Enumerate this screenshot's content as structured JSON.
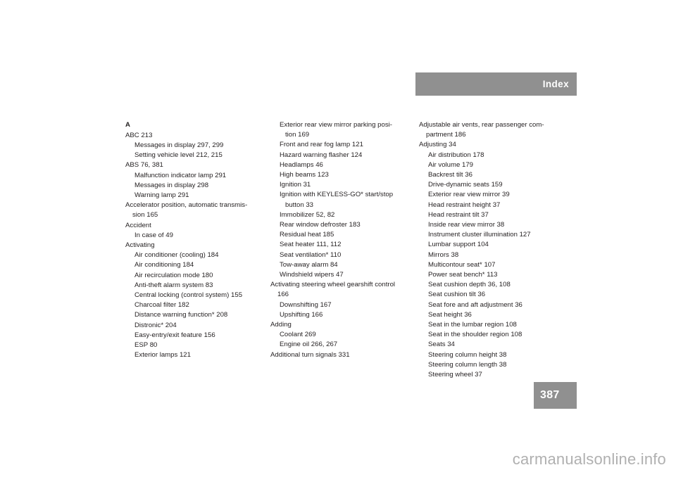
{
  "header": {
    "title": "Index",
    "bar_color": "#909090"
  },
  "page_number": {
    "value": "387",
    "box_color": "#909090"
  },
  "watermark": {
    "text": "carmanualsonline.info",
    "color": "#b0b0b0"
  },
  "columns": [
    {
      "id": "column-1",
      "entries": [
        {
          "level": "heading",
          "text": "A"
        },
        {
          "level": 0,
          "text": "ABC 213"
        },
        {
          "level": 1,
          "text": "Messages in display 297, 299"
        },
        {
          "level": 1,
          "text": "Setting vehicle level 212, 215"
        },
        {
          "level": 0,
          "text": "ABS 76, 381"
        },
        {
          "level": 1,
          "text": "Malfunction indicator lamp 291"
        },
        {
          "level": 1,
          "text": "Messages in display 298"
        },
        {
          "level": 1,
          "text": "Warning lamp 291"
        },
        {
          "level": 0,
          "text": "Accelerator position, automatic transmis-\nsion 165"
        },
        {
          "level": 0,
          "text": "Accident"
        },
        {
          "level": 1,
          "text": "In case of 49"
        },
        {
          "level": 0,
          "text": "Activating"
        },
        {
          "level": 1,
          "text": "Air conditioner (cooling) 184"
        },
        {
          "level": 1,
          "text": "Air conditioning 184"
        },
        {
          "level": 1,
          "text": "Air recirculation mode 180"
        },
        {
          "level": 1,
          "text": "Anti-theft alarm system 83"
        },
        {
          "level": 1,
          "text": "Central locking (control system) 155"
        },
        {
          "level": 1,
          "text": "Charcoal filter 182"
        },
        {
          "level": 1,
          "text": "Distance warning function* 208"
        },
        {
          "level": 1,
          "text": "Distronic* 204"
        },
        {
          "level": 1,
          "text": "Easy-entry/exit feature 156"
        },
        {
          "level": 1,
          "text": "ESP 80"
        },
        {
          "level": 1,
          "text": "Exterior lamps 121"
        }
      ]
    },
    {
      "id": "column-2",
      "entries": [
        {
          "level": 1,
          "text": "Exterior rear view mirror parking posi-\n   tion 169"
        },
        {
          "level": 1,
          "text": "Front and rear fog lamp 121"
        },
        {
          "level": 1,
          "text": "Hazard warning flasher 124"
        },
        {
          "level": 1,
          "text": "Headlamps 46"
        },
        {
          "level": 1,
          "text": "High beams 123"
        },
        {
          "level": 1,
          "text": "Ignition 31"
        },
        {
          "level": 1,
          "text": "Ignition with KEYLESS-GO* start/stop\n   button 33"
        },
        {
          "level": 1,
          "text": "Immobilizer 52, 82"
        },
        {
          "level": 1,
          "text": "Rear window defroster 183"
        },
        {
          "level": 1,
          "text": "Residual heat 185"
        },
        {
          "level": 1,
          "text": "Seat heater 111, 112"
        },
        {
          "level": 1,
          "text": "Seat ventilation* 110"
        },
        {
          "level": 1,
          "text": "Tow-away alarm 84"
        },
        {
          "level": 1,
          "text": "Windshield wipers 47"
        },
        {
          "level": 0,
          "text": "Activating steering wheel gearshift control\n166"
        },
        {
          "level": 1,
          "text": "Downshifting 167"
        },
        {
          "level": 1,
          "text": "Upshifting 166"
        },
        {
          "level": 0,
          "text": "Adding"
        },
        {
          "level": 1,
          "text": "Coolant 269"
        },
        {
          "level": 1,
          "text": "Engine oil 266, 267"
        },
        {
          "level": 0,
          "text": "Additional turn signals 331"
        }
      ]
    },
    {
      "id": "column-3",
      "entries": [
        {
          "level": 0,
          "text": "Adjustable air vents, rear passenger com-\npartment 186"
        },
        {
          "level": 0,
          "text": "Adjusting 34"
        },
        {
          "level": 1,
          "text": "Air distribution 178"
        },
        {
          "level": 1,
          "text": "Air volume 179"
        },
        {
          "level": 1,
          "text": "Backrest tilt 36"
        },
        {
          "level": 1,
          "text": "Drive-dynamic seats 159"
        },
        {
          "level": 1,
          "text": "Exterior rear view mirror 39"
        },
        {
          "level": 1,
          "text": "Head restraint height 37"
        },
        {
          "level": 1,
          "text": "Head restraint tilt 37"
        },
        {
          "level": 1,
          "text": "Inside rear view mirror 38"
        },
        {
          "level": 1,
          "text": "Instrument cluster illumination 127"
        },
        {
          "level": 1,
          "text": "Lumbar support 104"
        },
        {
          "level": 1,
          "text": "Mirrors 38"
        },
        {
          "level": 1,
          "text": "Multicontour seat* 107"
        },
        {
          "level": 1,
          "text": "Power seat bench* 113"
        },
        {
          "level": 1,
          "text": "Seat cushion depth 36, 108"
        },
        {
          "level": 1,
          "text": "Seat cushion tilt 36"
        },
        {
          "level": 1,
          "text": "Seat fore and aft adjustment 36"
        },
        {
          "level": 1,
          "text": "Seat height 36"
        },
        {
          "level": 1,
          "text": "Seat in the lumbar region 108"
        },
        {
          "level": 1,
          "text": "Seat in the shoulder region 108"
        },
        {
          "level": 1,
          "text": "Seats 34"
        },
        {
          "level": 1,
          "text": "Steering column height 38"
        },
        {
          "level": 1,
          "text": "Steering column length 38"
        },
        {
          "level": 1,
          "text": "Steering wheel 37"
        }
      ]
    }
  ]
}
